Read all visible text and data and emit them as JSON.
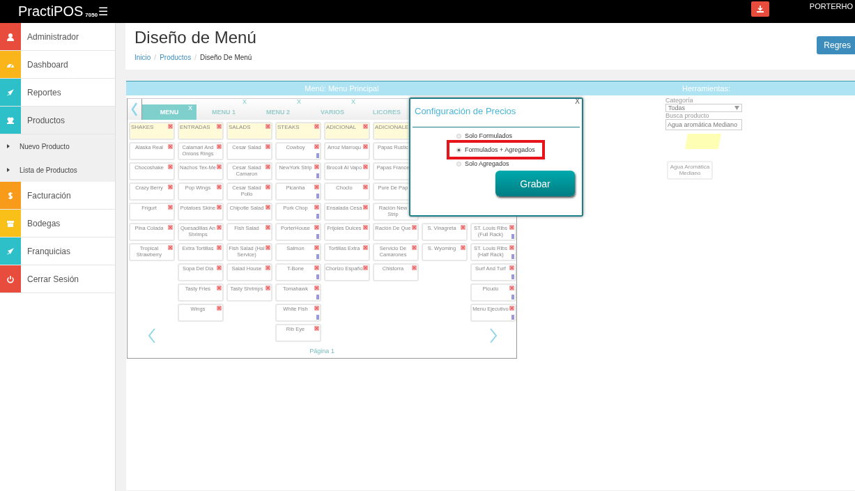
{
  "topbar": {
    "brand": "PractiPOS",
    "version": "7050",
    "menu_icon": "☰",
    "user": "PORTERHO"
  },
  "sidebar": {
    "items": [
      {
        "label": "Administrador",
        "color": "#e74c3c",
        "selected": false
      },
      {
        "label": "Dashboard",
        "color": "#f9b51a",
        "selected": false
      },
      {
        "label": "Reportes",
        "color": "#2ec0c9",
        "selected": false
      },
      {
        "label": "Productos",
        "color": "#2ec0c9",
        "selected": true,
        "children": [
          {
            "label": "Nuevo Producto"
          },
          {
            "label": "Lista de Productos"
          }
        ]
      },
      {
        "label": "Facturación",
        "color": "#f99b1a",
        "selected": false
      },
      {
        "label": "Bodegas",
        "color": "#f9c01a",
        "selected": false
      },
      {
        "label": "Franquicias",
        "color": "#2ec0c9",
        "selected": false
      },
      {
        "label": "Cerrar Sesión",
        "color": "#e74c3c",
        "selected": false
      }
    ]
  },
  "page": {
    "title": "Diseño de Menú",
    "breadcrumb": [
      {
        "label": "Inicio",
        "link": true
      },
      {
        "separator": "/",
        "label": "Productos",
        "link": true
      },
      {
        "separator": "/",
        "label": "Diseño De Menú",
        "link": false
      }
    ],
    "back_button": "Regres"
  },
  "menu_panel": {
    "title": "Menú: Menu Principal",
    "tabs": [
      {
        "label": "MENU",
        "selected": true,
        "close": "X"
      },
      {
        "label": "MENU 1",
        "selected": false,
        "close": "X"
      },
      {
        "label": "MENU 2",
        "selected": false,
        "close": "X"
      },
      {
        "label": "VARIOS",
        "selected": false,
        "close": "X"
      },
      {
        "label": "LICORES",
        "selected": false
      }
    ],
    "rows": [
      [
        {
          "kind": "header",
          "label": "SHAKES"
        },
        {
          "kind": "header",
          "label": "ENTRADAS"
        },
        {
          "kind": "header",
          "label": "SALADS"
        },
        {
          "kind": "header",
          "label": "STEAKS"
        },
        {
          "kind": "header",
          "label": "ADICIONAL"
        },
        {
          "kind": "covered-header",
          "label": "ADICIONALE"
        },
        {
          "kind": "empty"
        },
        {
          "kind": "empty"
        }
      ],
      [
        {
          "kind": "item",
          "label": "Alaska Real",
          "marked": false
        },
        {
          "kind": "item",
          "label": "Calamari And Onions Rings",
          "marked": false
        },
        {
          "kind": "item",
          "label": "Cesar Salad",
          "marked": false
        },
        {
          "kind": "item",
          "label": "Cowboy",
          "marked": true
        },
        {
          "kind": "item",
          "label": "Arroz Marroqu",
          "marked": false
        },
        {
          "kind": "covered-item",
          "label": "Papas Rustic"
        },
        {
          "kind": "empty"
        },
        {
          "kind": "empty"
        }
      ],
      [
        {
          "kind": "item",
          "label": "Chocoshake",
          "marked": false
        },
        {
          "kind": "item",
          "label": "Nachos Tex-Me",
          "marked": false
        },
        {
          "kind": "item",
          "label": "Cesar Salad Camaron",
          "marked": false
        },
        {
          "kind": "item",
          "label": "NewYork Strip",
          "marked": true
        },
        {
          "kind": "item",
          "label": "Brocoli Al Vapo",
          "marked": false
        },
        {
          "kind": "covered-item",
          "label": "Papas France"
        },
        {
          "kind": "empty"
        },
        {
          "kind": "empty"
        }
      ],
      [
        {
          "kind": "item",
          "label": "Crazy Berry",
          "marked": false
        },
        {
          "kind": "item",
          "label": "Pop Wings",
          "marked": false
        },
        {
          "kind": "item",
          "label": "Cesar Salad Pollo",
          "marked": false
        },
        {
          "kind": "item",
          "label": "Picanha",
          "marked": true
        },
        {
          "kind": "item",
          "label": "Choclo",
          "marked": false
        },
        {
          "kind": "covered-item",
          "label": "Pure De Pap"
        },
        {
          "kind": "empty"
        },
        {
          "kind": "empty"
        }
      ],
      [
        {
          "kind": "item",
          "label": "Frigurt",
          "marked": false
        },
        {
          "kind": "item",
          "label": "Potatoes Skine",
          "marked": false
        },
        {
          "kind": "item",
          "label": "Chipotle Salad",
          "marked": false
        },
        {
          "kind": "item",
          "label": "Pork Chop",
          "marked": true
        },
        {
          "kind": "item",
          "label": "Ensalada Cesa",
          "marked": false
        },
        {
          "kind": "item",
          "label": "Ración New Strip",
          "marked": false
        },
        {
          "kind": "empty"
        },
        {
          "kind": "empty"
        }
      ],
      [
        {
          "kind": "item",
          "label": "Pina Colada",
          "marked": false
        },
        {
          "kind": "item",
          "label": "Quesadillas An Shrimps",
          "marked": false
        },
        {
          "kind": "item",
          "label": "Fish Salad",
          "marked": false
        },
        {
          "kind": "item",
          "label": "PorterHouse",
          "marked": true
        },
        {
          "kind": "item",
          "label": "Frijoles Dulces",
          "marked": false
        },
        {
          "kind": "item",
          "label": "Ración De Que",
          "marked": false
        },
        {
          "kind": "item",
          "label": "S. Vinagreta",
          "marked": false
        },
        {
          "kind": "item",
          "label": "ST. Louis Ribs (Full Rack)",
          "marked": true
        }
      ],
      [
        {
          "kind": "item",
          "label": "Tropical Strawberry",
          "marked": false
        },
        {
          "kind": "item",
          "label": "Extra Tortillas",
          "marked": false
        },
        {
          "kind": "item",
          "label": "Fish Salad (Hal Service)",
          "marked": false
        },
        {
          "kind": "item",
          "label": "Salmon",
          "marked": true
        },
        {
          "kind": "item",
          "label": "Tortillas Extra",
          "marked": false
        },
        {
          "kind": "item",
          "label": "Servicio De Camarones",
          "marked": false
        },
        {
          "kind": "item",
          "label": "S. Wyoming",
          "marked": false
        },
        {
          "kind": "item",
          "label": "ST. Louis Ribs (Half Rack)",
          "marked": true
        }
      ],
      [
        {
          "kind": "empty"
        },
        {
          "kind": "item",
          "label": "Sopa Del Dia",
          "marked": false
        },
        {
          "kind": "item",
          "label": "Salad House",
          "marked": false
        },
        {
          "kind": "item",
          "label": "T-Bone",
          "marked": true
        },
        {
          "kind": "item",
          "label": "Chorizo Españo",
          "marked": false
        },
        {
          "kind": "item",
          "label": "Chistorra",
          "marked": false
        },
        {
          "kind": "empty"
        },
        {
          "kind": "item",
          "label": "Surf And Turf",
          "marked": true
        }
      ],
      [
        {
          "kind": "empty"
        },
        {
          "kind": "item",
          "label": "Tasty Fries",
          "marked": false
        },
        {
          "kind": "item",
          "label": "Tasty Shrimps",
          "marked": false
        },
        {
          "kind": "item",
          "label": "Tomahawk",
          "marked": true
        },
        {
          "kind": "empty"
        },
        {
          "kind": "empty"
        },
        {
          "kind": "empty"
        },
        {
          "kind": "item",
          "label": "Picudo",
          "marked": true
        }
      ],
      [
        {
          "kind": "empty"
        },
        {
          "kind": "item",
          "label": "Wings",
          "marked": false
        },
        {
          "kind": "empty"
        },
        {
          "kind": "item",
          "label": "White Fish",
          "marked": true
        },
        {
          "kind": "empty"
        },
        {
          "kind": "empty"
        },
        {
          "kind": "empty"
        },
        {
          "kind": "item",
          "label": "Menu Ejecutivo",
          "marked": true
        }
      ],
      [
        {
          "kind": "prev"
        },
        {
          "kind": "empty"
        },
        {
          "kind": "empty"
        },
        {
          "kind": "item",
          "label": "Rib Eye",
          "marked": false
        },
        {
          "kind": "empty"
        },
        {
          "kind": "empty"
        },
        {
          "kind": "empty"
        },
        {
          "kind": "next"
        }
      ]
    ],
    "page_label": "Página 1"
  },
  "tools_panel": {
    "title": "Herramientas:",
    "category_label": "Categoría",
    "category_value": "Todas",
    "search_label": "Busca producto",
    "search_value": "Agua aromática Mediano",
    "product_tile": "Agua Aromática Mediano"
  },
  "dialog": {
    "title": "Configuración de Precios",
    "close": "X",
    "options": [
      {
        "label": "Solo Formulados",
        "selected": false,
        "highlighted": false
      },
      {
        "label": "Formulados + Agregados",
        "selected": true,
        "highlighted": true
      },
      {
        "label": "Solo Agregados",
        "selected": false,
        "highlighted": false
      }
    ],
    "save_button": "Grabar"
  }
}
